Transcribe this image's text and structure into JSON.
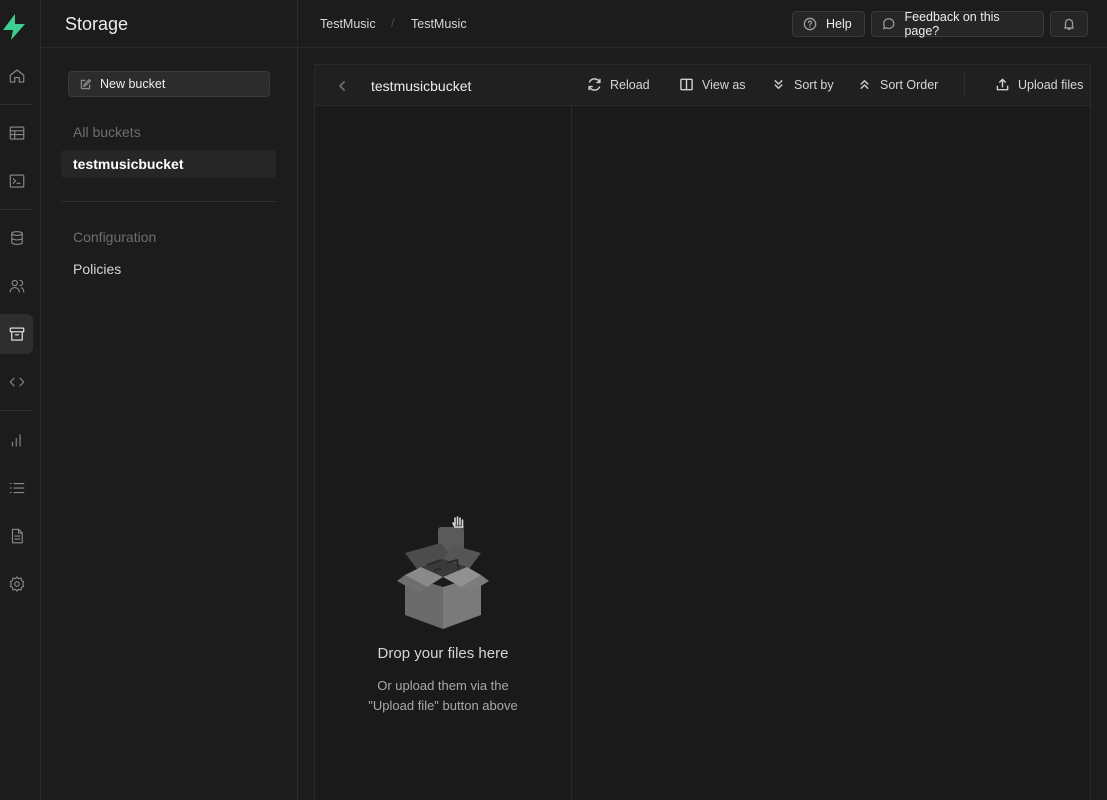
{
  "app": {
    "section_title": "Storage"
  },
  "breadcrumb": [
    "TestMusic",
    "TestMusic"
  ],
  "topbar": {
    "help_label": "Help",
    "feedback_label": "Feedback on this page?"
  },
  "rail": {
    "icons": [
      "home-icon",
      "table-editor-icon",
      "sql-editor-icon",
      "database-icon",
      "users-icon",
      "storage-icon",
      "api-icon",
      "reports-icon",
      "logs-icon",
      "docs-icon",
      "settings-icon"
    ],
    "active": "storage-icon",
    "accent_color": "#3ecf8e"
  },
  "sidebar": {
    "new_bucket_label": "New bucket",
    "all_buckets_label": "All buckets",
    "buckets": [
      "testmusicbucket"
    ],
    "configuration_label": "Configuration",
    "policies_label": "Policies"
  },
  "explorer": {
    "bucket_name": "testmusicbucket",
    "reload_label": "Reload",
    "view_as_label": "View as",
    "sort_by_label": "Sort by",
    "sort_order_label": "Sort Order",
    "upload_label": "Upload files",
    "empty_title": "Drop your files here",
    "empty_subtitle": "Or upload them via the \"Upload file\" button above"
  }
}
